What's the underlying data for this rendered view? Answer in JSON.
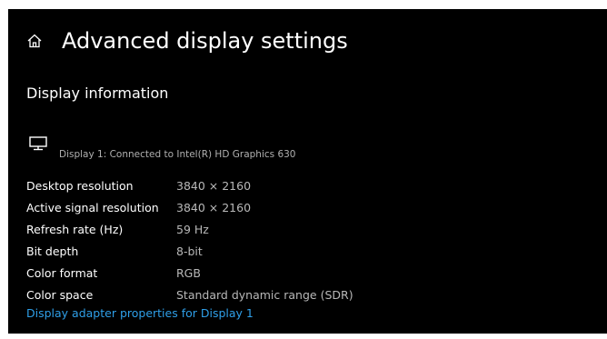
{
  "header": {
    "home_icon": "home-icon",
    "title": "Advanced display settings"
  },
  "section": {
    "title": "Display information"
  },
  "display": {
    "icon": "monitor-icon",
    "caption": "Display 1: Connected to Intel(R) HD Graphics 630"
  },
  "info": [
    {
      "label": "Desktop resolution",
      "value": "3840 × 2160"
    },
    {
      "label": "Active signal resolution",
      "value": "3840 × 2160"
    },
    {
      "label": "Refresh rate (Hz)",
      "value": "59 Hz"
    },
    {
      "label": "Bit depth",
      "value": "8-bit"
    },
    {
      "label": "Color format",
      "value": "RGB"
    },
    {
      "label": "Color space",
      "value": "Standard dynamic range (SDR)"
    }
  ],
  "link": {
    "label": "Display adapter properties for Display 1",
    "color": "#2f9fe8"
  },
  "colors": {
    "background": "#000000",
    "text": "#ffffff",
    "secondary_text": "#b8b8b8",
    "accent": "#2f9fe8"
  }
}
